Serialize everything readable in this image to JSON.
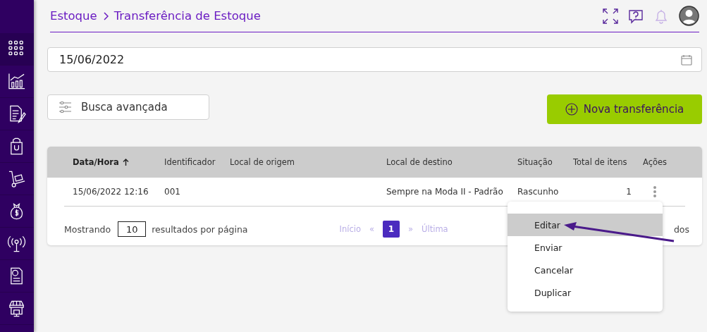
{
  "sidebar": {
    "items": [
      {
        "kind": "grid",
        "selected": true
      },
      {
        "kind": "chart",
        "selected": false
      },
      {
        "kind": "document",
        "selected": false
      },
      {
        "kind": "bag",
        "selected": false
      },
      {
        "kind": "cart",
        "selected": false
      },
      {
        "kind": "money",
        "selected": false
      },
      {
        "kind": "antenna",
        "selected": false
      },
      {
        "kind": "receipt",
        "selected": false
      },
      {
        "kind": "store",
        "selected": false
      }
    ]
  },
  "breadcrumb": [
    "Estoque",
    "Transferência de Estoque"
  ],
  "date_field": {
    "value": "15/06/2022"
  },
  "advanced_search": {
    "label": "Busca avançada"
  },
  "new_button": {
    "label": "Nova transferência"
  },
  "table": {
    "columns": [
      {
        "label": "Data/Hora",
        "sorted": true
      },
      {
        "label": "Identificador",
        "sorted": false
      },
      {
        "label": "Local de origem",
        "sorted": false
      },
      {
        "label": "Local de destino",
        "sorted": false
      },
      {
        "label": "Situação",
        "sorted": false
      },
      {
        "label": "Total de itens",
        "sorted": false
      },
      {
        "label": "Ações",
        "sorted": false
      }
    ],
    "rows": [
      {
        "cells": [
          "15/06/2022 12:16",
          "001",
          "",
          "Sempre na Moda II - Padrão",
          "Rascunho",
          "1"
        ]
      }
    ],
    "footer": {
      "showing": "Mostrando",
      "page_size": "10",
      "per_page": "resultados por página",
      "first": "Início",
      "prev": "«",
      "pages": [
        {
          "label": "1",
          "selected": true
        }
      ],
      "next": "»",
      "last": "Última",
      "summary_tail": "dos"
    }
  },
  "actions_menu": {
    "items": [
      {
        "label": "Editar",
        "selected": true
      },
      {
        "label": "Enviar",
        "selected": false
      },
      {
        "label": "Cancelar",
        "selected": false
      },
      {
        "label": "Duplicar",
        "selected": false
      }
    ]
  }
}
